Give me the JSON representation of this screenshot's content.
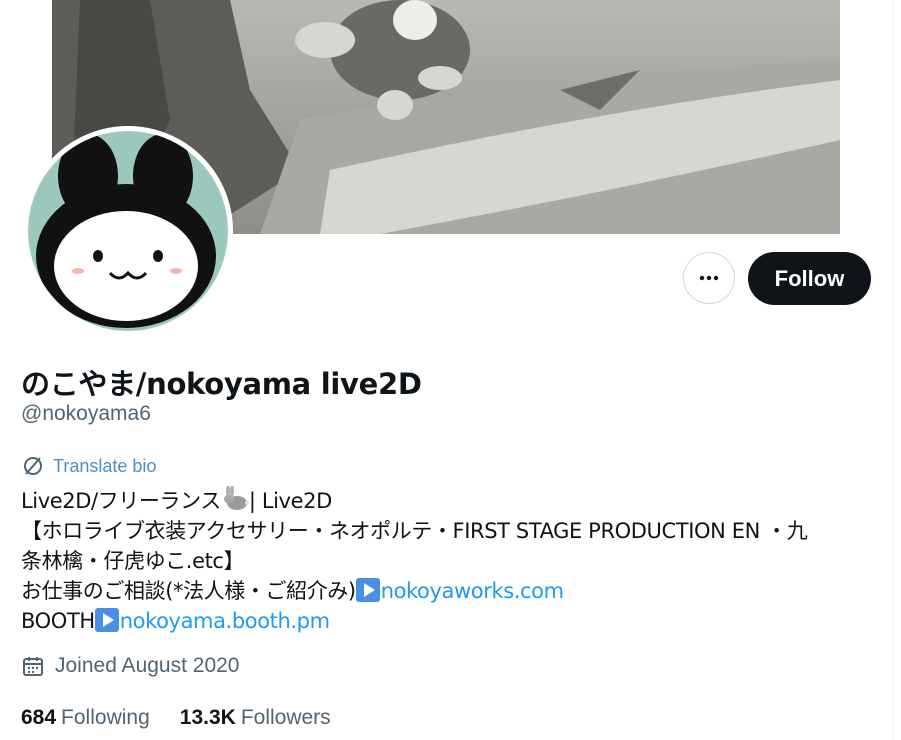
{
  "profile": {
    "display_name": "のこやま/nokoyama live2D",
    "handle": "@nokoyama6",
    "translate_label": "Translate bio",
    "bio": {
      "line1_prefix": "Live2D/フリーランス",
      "line1_suffix": "| Live2D",
      "line2": "【ホロライブ衣装アクセサリー・ネオポルテ・FIRST STAGE PRODUCTION EN ・九",
      "line3": "条林檎・仔虎ゆこ.etc】",
      "line4_prefix": "お仕事のご相談(*法人様・ご紹介み)",
      "line4_link": "nokoyaworks.com",
      "line5_prefix": "BOOTH",
      "line5_link": "nokoyama.booth.pm"
    },
    "joined": "Joined August 2020",
    "following_count": "684",
    "following_label": "Following",
    "followers_count": "13.3K",
    "followers_label": "Followers"
  },
  "actions": {
    "follow_label": "Follow"
  },
  "icons": {
    "more": "more-horizontal-icon",
    "translate": "translate-icon",
    "calendar": "calendar-icon",
    "rabbit": "rabbit-emoji-icon",
    "play": "play-button-emoji-icon"
  },
  "colors": {
    "link": "#1d9bf0",
    "follow_bg": "#0f1419",
    "muted": "#536471",
    "avatar_bg": "#9cc8be"
  }
}
